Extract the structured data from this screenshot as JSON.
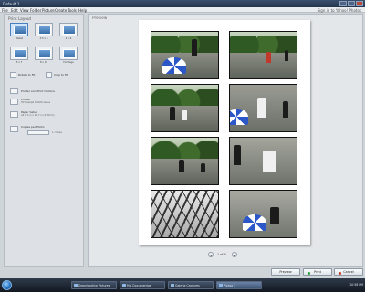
{
  "window": {
    "title": "Default 1",
    "top_right_link": "Sign in to Yahoo! Photos"
  },
  "menu": [
    "File",
    "Edit",
    "View",
    "Folder",
    "Picture",
    "Create",
    "Tools",
    "Help"
  ],
  "left_panel": {
    "heading": "Print Layout",
    "layouts": [
      {
        "label": "Wallet",
        "selected": true
      },
      {
        "label": "3.5 x 5",
        "selected": false
      },
      {
        "label": "4 x 6",
        "selected": false
      },
      {
        "label": "5 x 7",
        "selected": false
      },
      {
        "label": "8 x 10",
        "selected": false
      },
      {
        "label": "Full Page",
        "selected": false
      }
    ],
    "rotate_label": "Rotate to Fit",
    "crop_label": "Crop to Fit",
    "options_label": "Printer and Print Options",
    "printer_label": "Printer",
    "printer_value": "HP Deskjet D4100 series",
    "paper_label": "Paper Setup",
    "paper_value": "A4 8.3 in x 11.7 in (210mm)",
    "copies_label": "Copies per Photo",
    "copies_value": "1 copies"
  },
  "preview": {
    "heading": "Preview",
    "pager_text": "1 of 4",
    "prev_symbol": "◂",
    "next_symbol": "▸"
  },
  "buttons": {
    "preview": "Preview",
    "print": "Print",
    "cancel": "Cancel",
    "print_color": "#2a9d3a",
    "cancel_color": "#c93a2a"
  },
  "taskbar": {
    "items": [
      {
        "label": "Downloading Pictures",
        "active": false
      },
      {
        "label": "Mis Documentos",
        "active": false
      },
      {
        "label": "Galeria Captures",
        "active": false
      },
      {
        "label": "Picasa 3",
        "active": true
      }
    ],
    "clock": "10:58 PM"
  }
}
